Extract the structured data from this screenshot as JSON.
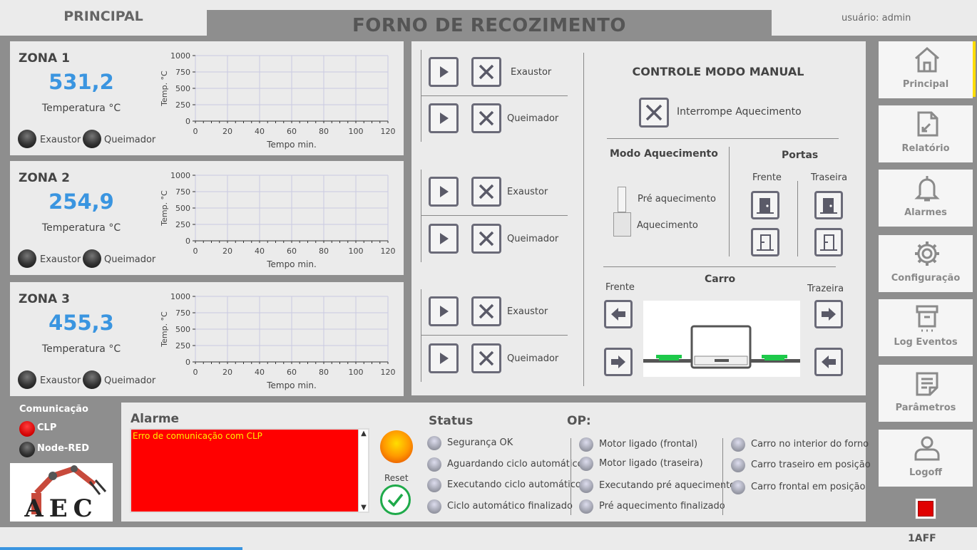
{
  "header": {
    "tab": "PRINCIPAL",
    "title": "FORNO DE RECOZIMENTO",
    "user": "usuário: admin"
  },
  "zones": [
    {
      "name": "ZONA 1",
      "value": "531,2",
      "label": "Temperatura °C",
      "exaustor": "Exaustor",
      "queimador": "Queimador"
    },
    {
      "name": "ZONA 2",
      "value": "254,9",
      "label": "Temperatura °C",
      "exaustor": "Exaustor",
      "queimador": "Queimador"
    },
    {
      "name": "ZONA 3",
      "value": "455,3",
      "label": "Temperatura °C",
      "exaustor": "Exaustor",
      "queimador": "Queimador"
    }
  ],
  "chart_data": [
    {
      "type": "line",
      "xlabel": "Tempo min.",
      "ylabel": "Temp. °C",
      "xlim": [
        0,
        120
      ],
      "ylim": [
        0,
        1000
      ],
      "xticks": [
        0,
        20,
        40,
        60,
        80,
        100,
        120
      ],
      "yticks": [
        0,
        250,
        500,
        750,
        1000
      ],
      "grid": true,
      "series": []
    },
    {
      "type": "line",
      "xlabel": "Tempo min.",
      "ylabel": "Temp. °C",
      "xlim": [
        0,
        120
      ],
      "ylim": [
        0,
        1000
      ],
      "xticks": [
        0,
        20,
        40,
        60,
        80,
        100,
        120
      ],
      "yticks": [
        0,
        250,
        500,
        750,
        1000
      ],
      "grid": true,
      "series": []
    },
    {
      "type": "line",
      "xlabel": "Tempo min.",
      "ylabel": "Temp. °C",
      "xlim": [
        0,
        120
      ],
      "ylim": [
        0,
        1000
      ],
      "xticks": [
        0,
        20,
        40,
        60,
        80,
        100,
        120
      ],
      "yticks": [
        0,
        250,
        500,
        750,
        1000
      ],
      "grid": true,
      "series": []
    }
  ],
  "controls": [
    {
      "exaustor": "Exaustor",
      "queimador": "Queimador"
    },
    {
      "exaustor": "Exaustor",
      "queimador": "Queimador"
    },
    {
      "exaustor": "Exaustor",
      "queimador": "Queimador"
    }
  ],
  "manual": {
    "title": "CONTROLE MODO MANUAL",
    "interrupt": "Interrompe Aquecimento",
    "mode_title": "Modo Aquecimento",
    "mode_pre": "Pré aquecimento",
    "mode_heat": "Aquecimento",
    "doors_title": "Portas",
    "door_front": "Frente",
    "door_rear": "Traseira",
    "cart_title": "Carro",
    "cart_front": "Frente",
    "cart_rear": "Trazeira"
  },
  "sidebar": [
    {
      "label": "Principal",
      "icon": "home-icon"
    },
    {
      "label": "Relatório",
      "icon": "report-icon"
    },
    {
      "label": "Alarmes",
      "icon": "bell-icon"
    },
    {
      "label": "Configuração",
      "icon": "gear-icon"
    },
    {
      "label": "Log Eventos",
      "icon": "archive-icon"
    },
    {
      "label": "Parâmetros",
      "icon": "notepad-icon"
    },
    {
      "label": "Logoff",
      "icon": "user-icon"
    }
  ],
  "comm": {
    "title": "Comunicação",
    "clp": "CLP",
    "nodered": "Node-RED"
  },
  "logo_text": "AEC",
  "alarm": {
    "title": "Alarme",
    "message": "Erro de comunicação com CLP",
    "reset": "Reset"
  },
  "status": {
    "title": "Status",
    "items": [
      "Segurança OK",
      "Aguardando ciclo automático",
      "Executando ciclo automático",
      "Ciclo automático finalizado"
    ]
  },
  "op": {
    "title": "OP:",
    "col1": [
      "Motor ligado (frontal)",
      "Motor ligado (traseira)",
      "Executando pré aquecimento",
      "Pré aquecimento finalizado"
    ],
    "col2": [
      "Carro no interior do forno",
      "Carro traseiro em posição",
      "Carro frontal em posição"
    ]
  },
  "footer": {
    "code": "1AFF"
  },
  "colors": {
    "accent": "#3a95e0",
    "alarm_bg": "#ff0000",
    "alarm_text": "#ffee00",
    "cart_green": "#1ec94a",
    "stop_red": "#e00000"
  }
}
